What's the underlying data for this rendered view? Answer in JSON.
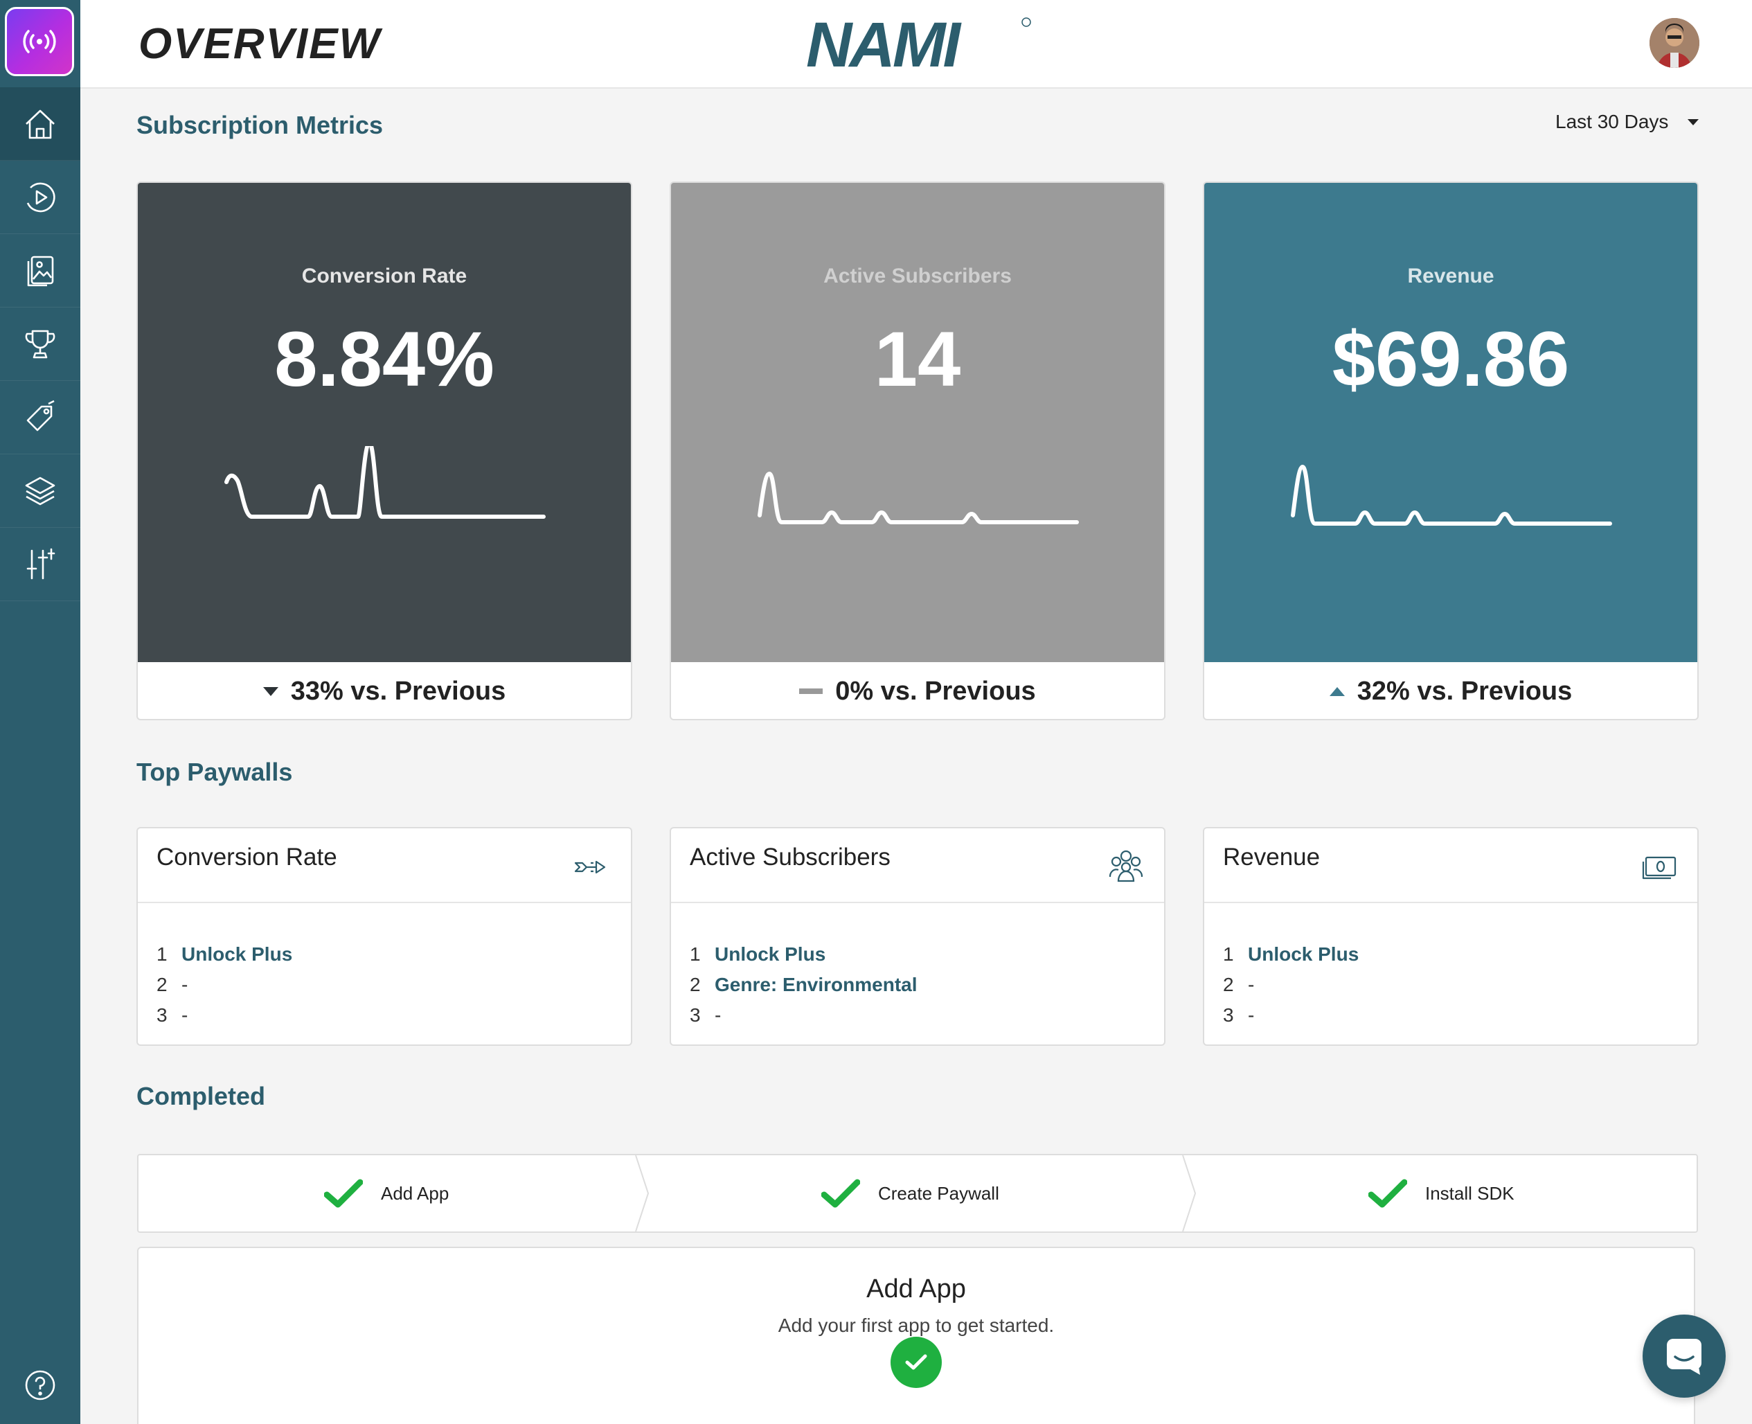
{
  "header": {
    "title": "OVERVIEW",
    "brand": "NAMI"
  },
  "sidebar": {
    "items": [
      {
        "icon": "home-icon"
      },
      {
        "icon": "play-circle-icon"
      },
      {
        "icon": "image-cards-icon"
      },
      {
        "icon": "trophy-icon"
      },
      {
        "icon": "tag-icon"
      },
      {
        "icon": "layers-icon"
      },
      {
        "icon": "sliders-icon"
      }
    ],
    "help_icon": "help-icon"
  },
  "subscription_metrics": {
    "title": "Subscription Metrics",
    "range": "Last 30 Days",
    "cards": [
      {
        "label": "Conversion Rate",
        "value": "8.84%",
        "change": "33% vs. Previous",
        "trend": "down",
        "bg": "#41494d",
        "label_color": "#e6e6e6"
      },
      {
        "label": "Active Subscribers",
        "value": "14",
        "change": "0% vs. Previous",
        "trend": "flat",
        "bg": "#9b9b9b",
        "label_color": "#cfcfcf"
      },
      {
        "label": "Revenue",
        "value": "$69.86",
        "change": "32% vs. Previous",
        "trend": "up",
        "bg": "#3d7a8e",
        "label_color": "#d9e6ea"
      }
    ]
  },
  "top_paywalls": {
    "title": "Top Paywalls",
    "cards": [
      {
        "title": "Conversion Rate",
        "icon": "conversion-arrow-icon",
        "rows": [
          {
            "num": "1",
            "name": "Unlock Plus"
          },
          {
            "num": "2",
            "name": "-"
          },
          {
            "num": "3",
            "name": "-"
          }
        ]
      },
      {
        "title": "Active Subscribers",
        "icon": "users-group-icon",
        "rows": [
          {
            "num": "1",
            "name": "Unlock Plus"
          },
          {
            "num": "2",
            "name": "Genre: Environmental"
          },
          {
            "num": "3",
            "name": "-"
          }
        ]
      },
      {
        "title": "Revenue",
        "icon": "cash-icon",
        "rows": [
          {
            "num": "1",
            "name": "Unlock Plus"
          },
          {
            "num": "2",
            "name": "-"
          },
          {
            "num": "3",
            "name": "-"
          }
        ]
      }
    ]
  },
  "completed": {
    "title": "Completed",
    "steps": [
      {
        "label": "Add App"
      },
      {
        "label": "Create Paywall"
      },
      {
        "label": "Install SDK"
      }
    ]
  },
  "add_app_panel": {
    "title": "Add App",
    "subtitle": "Add your first app to get started."
  },
  "colors": {
    "primary": "#2c5d6d",
    "success": "#1fb040",
    "accent_gradient": [
      "#7a3cf0",
      "#d234c8"
    ]
  }
}
